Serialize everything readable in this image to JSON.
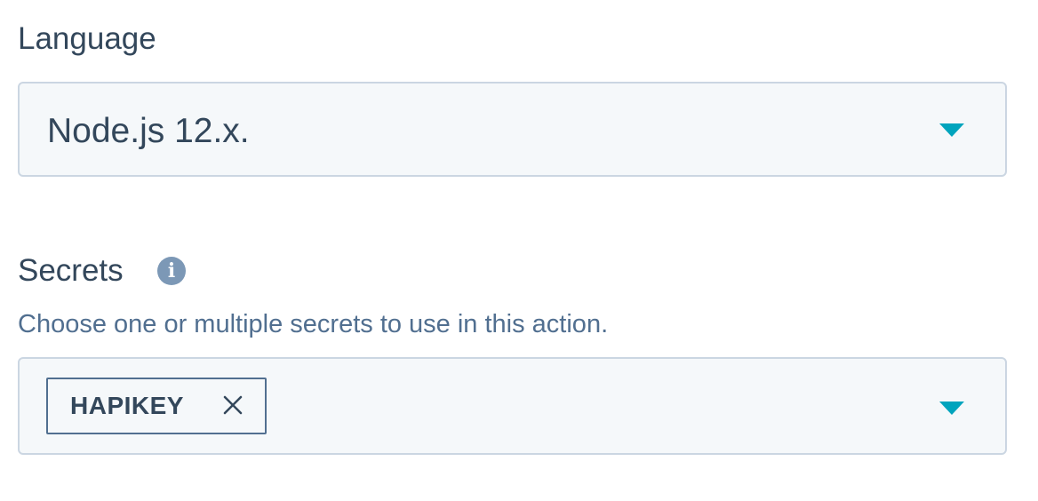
{
  "language": {
    "label": "Language",
    "selected_value": "Node.js 12.x."
  },
  "secrets": {
    "label": "Secrets",
    "help_text": "Choose one or multiple secrets to use in this action.",
    "selected_tags": [
      {
        "label": "HAPIKEY"
      }
    ]
  },
  "icons": {
    "info": "info-icon",
    "dropdown": "caret-down-icon",
    "remove": "close-icon"
  },
  "colors": {
    "text": "#33475b",
    "help_text": "#516f90",
    "field_background": "#f5f8fa",
    "field_border": "#cbd6e2",
    "caret": "#00a4bd",
    "tag_border": "#516f90"
  }
}
